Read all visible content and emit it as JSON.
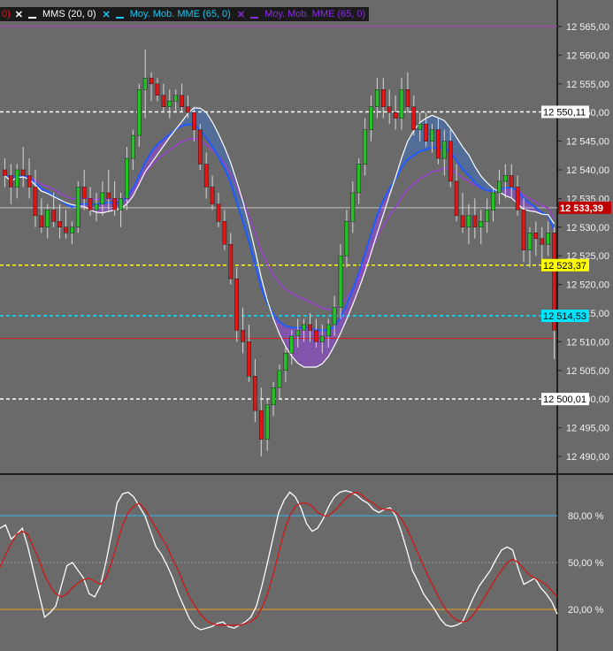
{
  "legend": {
    "first_fragment": "0)",
    "items": [
      {
        "label": "MMS (20, 0)",
        "color": "#ffffff",
        "x_color": "#ffffff"
      },
      {
        "label": "Moy. Mob. MME (65, 0)",
        "color": "#18c7f0",
        "x_color": "#18c7f0"
      },
      {
        "label": "Moy. Mob. MME (65, 0)",
        "color": "#8a2be2",
        "x_color": "#8a2be2"
      }
    ]
  },
  "colors": {
    "background": "#6a6a6a",
    "axis_panel": "#6a6a6a",
    "bull": "#22c322",
    "bear": "#e01515",
    "sma20": "#ffffff",
    "ema65_blue": "#1f5bff",
    "ema65_purple": "#9b3fd6",
    "fill_up": "#4a6fa8",
    "fill_down": "#8a4fc2",
    "stoch_k": "#ffffff",
    "stoch_d": "#d01818"
  },
  "chart_data": [
    {
      "type": "candlestick",
      "ylim": [
        12486,
        12570
      ],
      "price_tick_labels": [
        "12 565,00",
        "12 560,00",
        "12 555,00",
        "12 550,00",
        "12 545,00",
        "12 540,00",
        "12 535,00",
        "12 530,00",
        "12 525,00",
        "12 520,00",
        "12 515,00",
        "12 510,00",
        "12 505,00",
        "12 500,00",
        "12 495,00",
        "12 490,00"
      ],
      "price_ticks": [
        12565,
        12560,
        12555,
        12550,
        12545,
        12540,
        12535,
        12530,
        12525,
        12520,
        12515,
        12510,
        12505,
        12500,
        12495,
        12490
      ],
      "horizontal_lines": [
        {
          "value": 12550.11,
          "label": "12 550,11",
          "color": "#ffffff",
          "style": "dashed",
          "label_bg": "#ffffff",
          "label_fg": "#000000"
        },
        {
          "value": 12533.39,
          "label": "12 533,39",
          "color": "#c8c8c8",
          "style": "solid",
          "label_bg": "#c00000",
          "label_fg": "#ffffff"
        },
        {
          "value": 12523.37,
          "label": "12 523,37",
          "color": "#ffff00",
          "style": "dashed",
          "label_bg": "#ffff00",
          "label_fg": "#000000"
        },
        {
          "value": 12514.53,
          "label": "12 514,53",
          "color": "#00e5ff",
          "style": "dashed",
          "label_bg": "#00e5ff",
          "label_fg": "#000000"
        },
        {
          "value": 12510.6,
          "label": "",
          "color": "#e01515",
          "style": "solid"
        },
        {
          "value": 12500.01,
          "label": "12 500,01",
          "color": "#ffffff",
          "style": "dashed",
          "label_bg": "#ffffff",
          "label_fg": "#000000"
        },
        {
          "value": 12565.0,
          "label": "",
          "color": "#b43cc8",
          "style": "solid"
        }
      ],
      "ohlc": [
        [
          12540,
          12542,
          12537,
          12539
        ],
        [
          12539,
          12541,
          12534,
          12537
        ],
        [
          12537,
          12541,
          12535,
          12540
        ],
        [
          12540,
          12544,
          12537,
          12539
        ],
        [
          12539,
          12542,
          12535,
          12537
        ],
        [
          12537,
          12540,
          12530,
          12532
        ],
        [
          12532,
          12535,
          12529,
          12530
        ],
        [
          12530,
          12534,
          12528,
          12533
        ],
        [
          12533,
          12536,
          12530,
          12531
        ],
        [
          12531,
          12534,
          12528,
          12530
        ],
        [
          12530,
          12533,
          12528,
          12529
        ],
        [
          12529,
          12531,
          12527,
          12530
        ],
        [
          12530,
          12538,
          12529,
          12537
        ],
        [
          12537,
          12540,
          12533,
          12535
        ],
        [
          12535,
          12537,
          12532,
          12533
        ],
        [
          12533,
          12536,
          12531,
          12534
        ],
        [
          12534,
          12538,
          12532,
          12536
        ],
        [
          12536,
          12540,
          12533,
          12535
        ],
        [
          12535,
          12538,
          12532,
          12533
        ],
        [
          12533,
          12536,
          12530,
          12535
        ],
        [
          12535,
          12544,
          12533,
          12542
        ],
        [
          12542,
          12547,
          12540,
          12546
        ],
        [
          12546,
          12555,
          12544,
          12554
        ],
        [
          12554,
          12561,
          12549,
          12556
        ],
        [
          12556,
          12557,
          12552,
          12555
        ],
        [
          12555,
          12556,
          12552,
          12553
        ],
        [
          12553,
          12555,
          12550,
          12551
        ],
        [
          12551,
          12554,
          12549,
          12552
        ],
        [
          12552,
          12554,
          12550,
          12553
        ],
        [
          12553,
          12555,
          12550,
          12551
        ],
        [
          12551,
          12553,
          12549,
          12550
        ],
        [
          12550,
          12551,
          12545,
          12547
        ],
        [
          12547,
          12548,
          12540,
          12541
        ],
        [
          12541,
          12543,
          12535,
          12537
        ],
        [
          12537,
          12539,
          12533,
          12534
        ],
        [
          12534,
          12536,
          12530,
          12531
        ],
        [
          12531,
          12533,
          12526,
          12527
        ],
        [
          12527,
          12529,
          12520,
          12521
        ],
        [
          12521,
          12523,
          12510,
          12512
        ],
        [
          12512,
          12516,
          12508,
          12510
        ],
        [
          12510,
          12513,
          12503,
          12504
        ],
        [
          12504,
          12507,
          12496,
          12498
        ],
        [
          12498,
          12502,
          12490,
          12493
        ],
        [
          12493,
          12500,
          12491,
          12499
        ],
        [
          12499,
          12503,
          12497,
          12502
        ],
        [
          12502,
          12506,
          12500,
          12505
        ],
        [
          12505,
          12509,
          12503,
          12508
        ],
        [
          12508,
          12512,
          12506,
          12511
        ],
        [
          12511,
          12514,
          12509,
          12512
        ],
        [
          12512,
          12514,
          12510,
          12513
        ],
        [
          12513,
          12515,
          12510,
          12512
        ],
        [
          12512,
          12514,
          12509,
          12510
        ],
        [
          12510,
          12513,
          12508,
          12511
        ],
        [
          12511,
          12514,
          12509,
          12513
        ],
        [
          12513,
          12518,
          12511,
          12516
        ],
        [
          12516,
          12527,
          12514,
          12525
        ],
        [
          12525,
          12533,
          12523,
          12531
        ],
        [
          12531,
          12538,
          12529,
          12536
        ],
        [
          12536,
          12542,
          12534,
          12541
        ],
        [
          12541,
          12549,
          12539,
          12547
        ],
        [
          12547,
          12553,
          12545,
          12551
        ],
        [
          12551,
          12556,
          12549,
          12554
        ],
        [
          12554,
          12556,
          12549,
          12551
        ],
        [
          12551,
          12554,
          12548,
          12550
        ],
        [
          12550,
          12553,
          12547,
          12549
        ],
        [
          12549,
          12556,
          12547,
          12554
        ],
        [
          12554,
          12557,
          12550,
          12551
        ],
        [
          12551,
          12553,
          12546,
          12547
        ],
        [
          12547,
          12550,
          12545,
          12548
        ],
        [
          12548,
          12550,
          12544,
          12545
        ],
        [
          12545,
          12548,
          12543,
          12547
        ],
        [
          12547,
          12549,
          12541,
          12542
        ],
        [
          12542,
          12547,
          12539,
          12545
        ],
        [
          12545,
          12547,
          12537,
          12538
        ],
        [
          12538,
          12541,
          12531,
          12532
        ],
        [
          12532,
          12536,
          12529,
          12530
        ],
        [
          12530,
          12534,
          12527,
          12532
        ],
        [
          12532,
          12535,
          12528,
          12530
        ],
        [
          12530,
          12533,
          12527,
          12531
        ],
        [
          12531,
          12535,
          12529,
          12533
        ],
        [
          12533,
          12537,
          12531,
          12536
        ],
        [
          12536,
          12540,
          12534,
          12538
        ],
        [
          12538,
          12541,
          12535,
          12539
        ],
        [
          12539,
          12541,
          12535,
          12537
        ],
        [
          12537,
          12539,
          12532,
          12533
        ],
        [
          12533,
          12535,
          12524,
          12526
        ],
        [
          12526,
          12530,
          12523,
          12529
        ],
        [
          12529,
          12531,
          12525,
          12528
        ],
        [
          12528,
          12530,
          12524,
          12527
        ],
        [
          12527,
          12531,
          12525,
          12529
        ],
        [
          12529,
          12530,
          12507,
          12512
        ]
      ]
    },
    {
      "type": "line",
      "ylim": [
        0,
        100
      ],
      "y_tick_labels": [
        "80,00 %",
        "50,00 %",
        "20,00 %"
      ],
      "y_ticks": [
        80,
        50,
        20
      ],
      "levels": [
        {
          "value": 80,
          "color": "#35b8f0",
          "style": "solid"
        },
        {
          "value": 50,
          "color": "#a0a0a0",
          "style": "dotted"
        },
        {
          "value": 20,
          "color": "#f0a020",
          "style": "solid"
        }
      ],
      "series": [
        {
          "color": "#ffffff",
          "values": [
            72,
            74,
            65,
            68,
            72,
            60,
            45,
            30,
            15,
            18,
            22,
            35,
            48,
            50,
            45,
            40,
            30,
            28,
            35,
            50,
            68,
            88,
            94,
            95,
            92,
            86,
            80,
            70,
            60,
            55,
            48,
            40,
            30,
            22,
            14,
            9,
            7,
            8,
            9,
            11,
            12,
            9,
            8,
            10,
            12,
            15,
            22,
            35,
            50,
            66,
            82,
            90,
            95,
            92,
            85,
            75,
            70,
            72,
            78,
            86,
            92,
            95,
            96,
            95,
            93,
            90,
            88,
            84,
            82,
            84,
            85,
            80,
            70,
            58,
            45,
            38,
            30,
            25,
            20,
            14,
            10,
            9,
            10,
            12,
            20,
            28,
            35,
            40,
            45,
            52,
            58,
            60,
            58,
            46,
            36,
            38,
            40,
            34,
            30,
            25,
            17
          ]
        },
        {
          "color": "#d01818",
          "values": [
            47,
            55,
            62,
            68,
            70,
            68,
            60,
            52,
            42,
            35,
            30,
            28,
            30,
            34,
            37,
            39,
            40,
            38,
            36,
            40,
            50,
            62,
            74,
            82,
            86,
            88,
            84,
            78,
            72,
            66,
            60,
            52,
            45,
            36,
            28,
            22,
            17,
            13,
            11,
            10,
            10,
            10,
            10,
            10,
            11,
            12,
            15,
            21,
            30,
            42,
            56,
            70,
            80,
            86,
            88,
            88,
            86,
            82,
            80,
            80,
            83,
            87,
            91,
            94,
            95,
            93,
            90,
            88,
            85,
            84,
            84,
            82,
            78,
            72,
            64,
            56,
            48,
            40,
            33,
            26,
            20,
            16,
            13,
            12,
            13,
            17,
            22,
            28,
            34,
            40,
            45,
            50,
            52,
            50,
            46,
            42,
            40,
            38,
            36,
            32,
            28
          ]
        }
      ]
    }
  ]
}
